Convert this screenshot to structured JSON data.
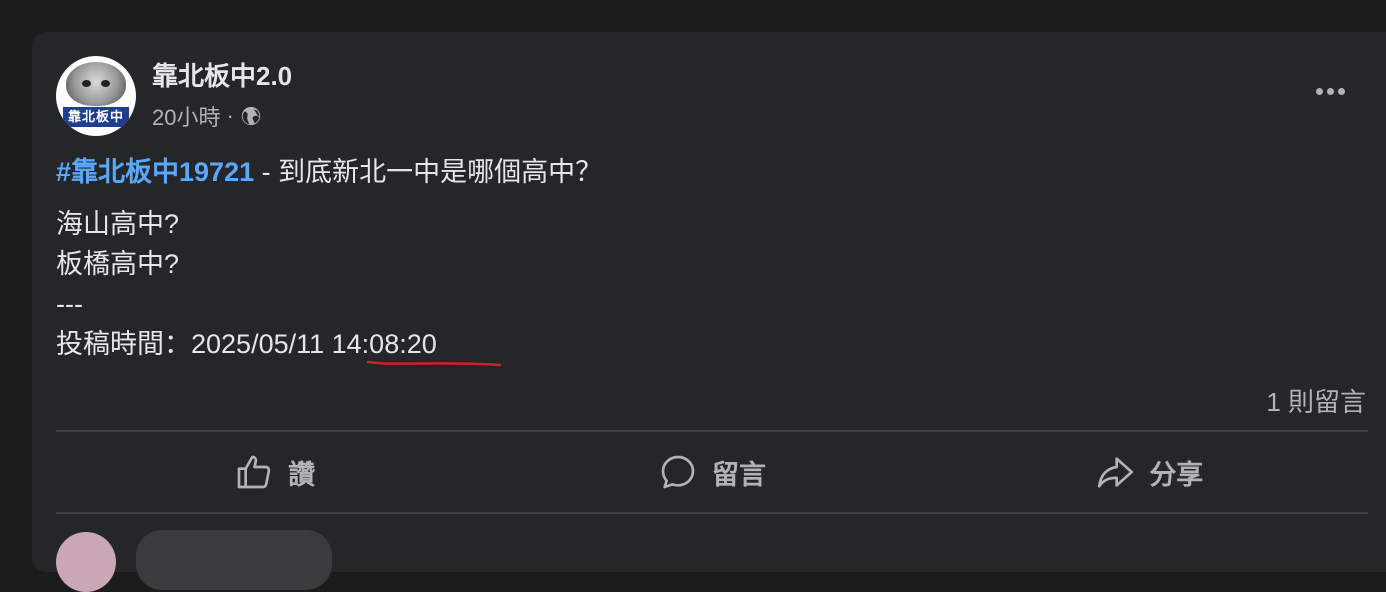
{
  "post": {
    "page_name": "靠北板中2.0",
    "avatar_text": "靠北板中",
    "time_ago": "20小時",
    "separator": "·",
    "privacy_icon": "globe-icon",
    "more_icon": "more-dots-icon",
    "hashtag": "#靠北板中19721",
    "title_rest": " - 到底新北一中是哪個高中？",
    "lines": [
      "海山高中?",
      "板橋高中?",
      "---"
    ],
    "posted_label": "投稿時間：",
    "posted_date": "2025/05/11 ",
    "posted_time": "14:08:20",
    "comment_count": "1 則留言",
    "actions": {
      "like_label": "讚",
      "comment_label": "留言",
      "share_label": "分享"
    }
  },
  "colors": {
    "background": "#1c1c1d",
    "card": "#252628",
    "hashtag": "#5aa7ff",
    "underline_annotation": "#d0202a"
  }
}
